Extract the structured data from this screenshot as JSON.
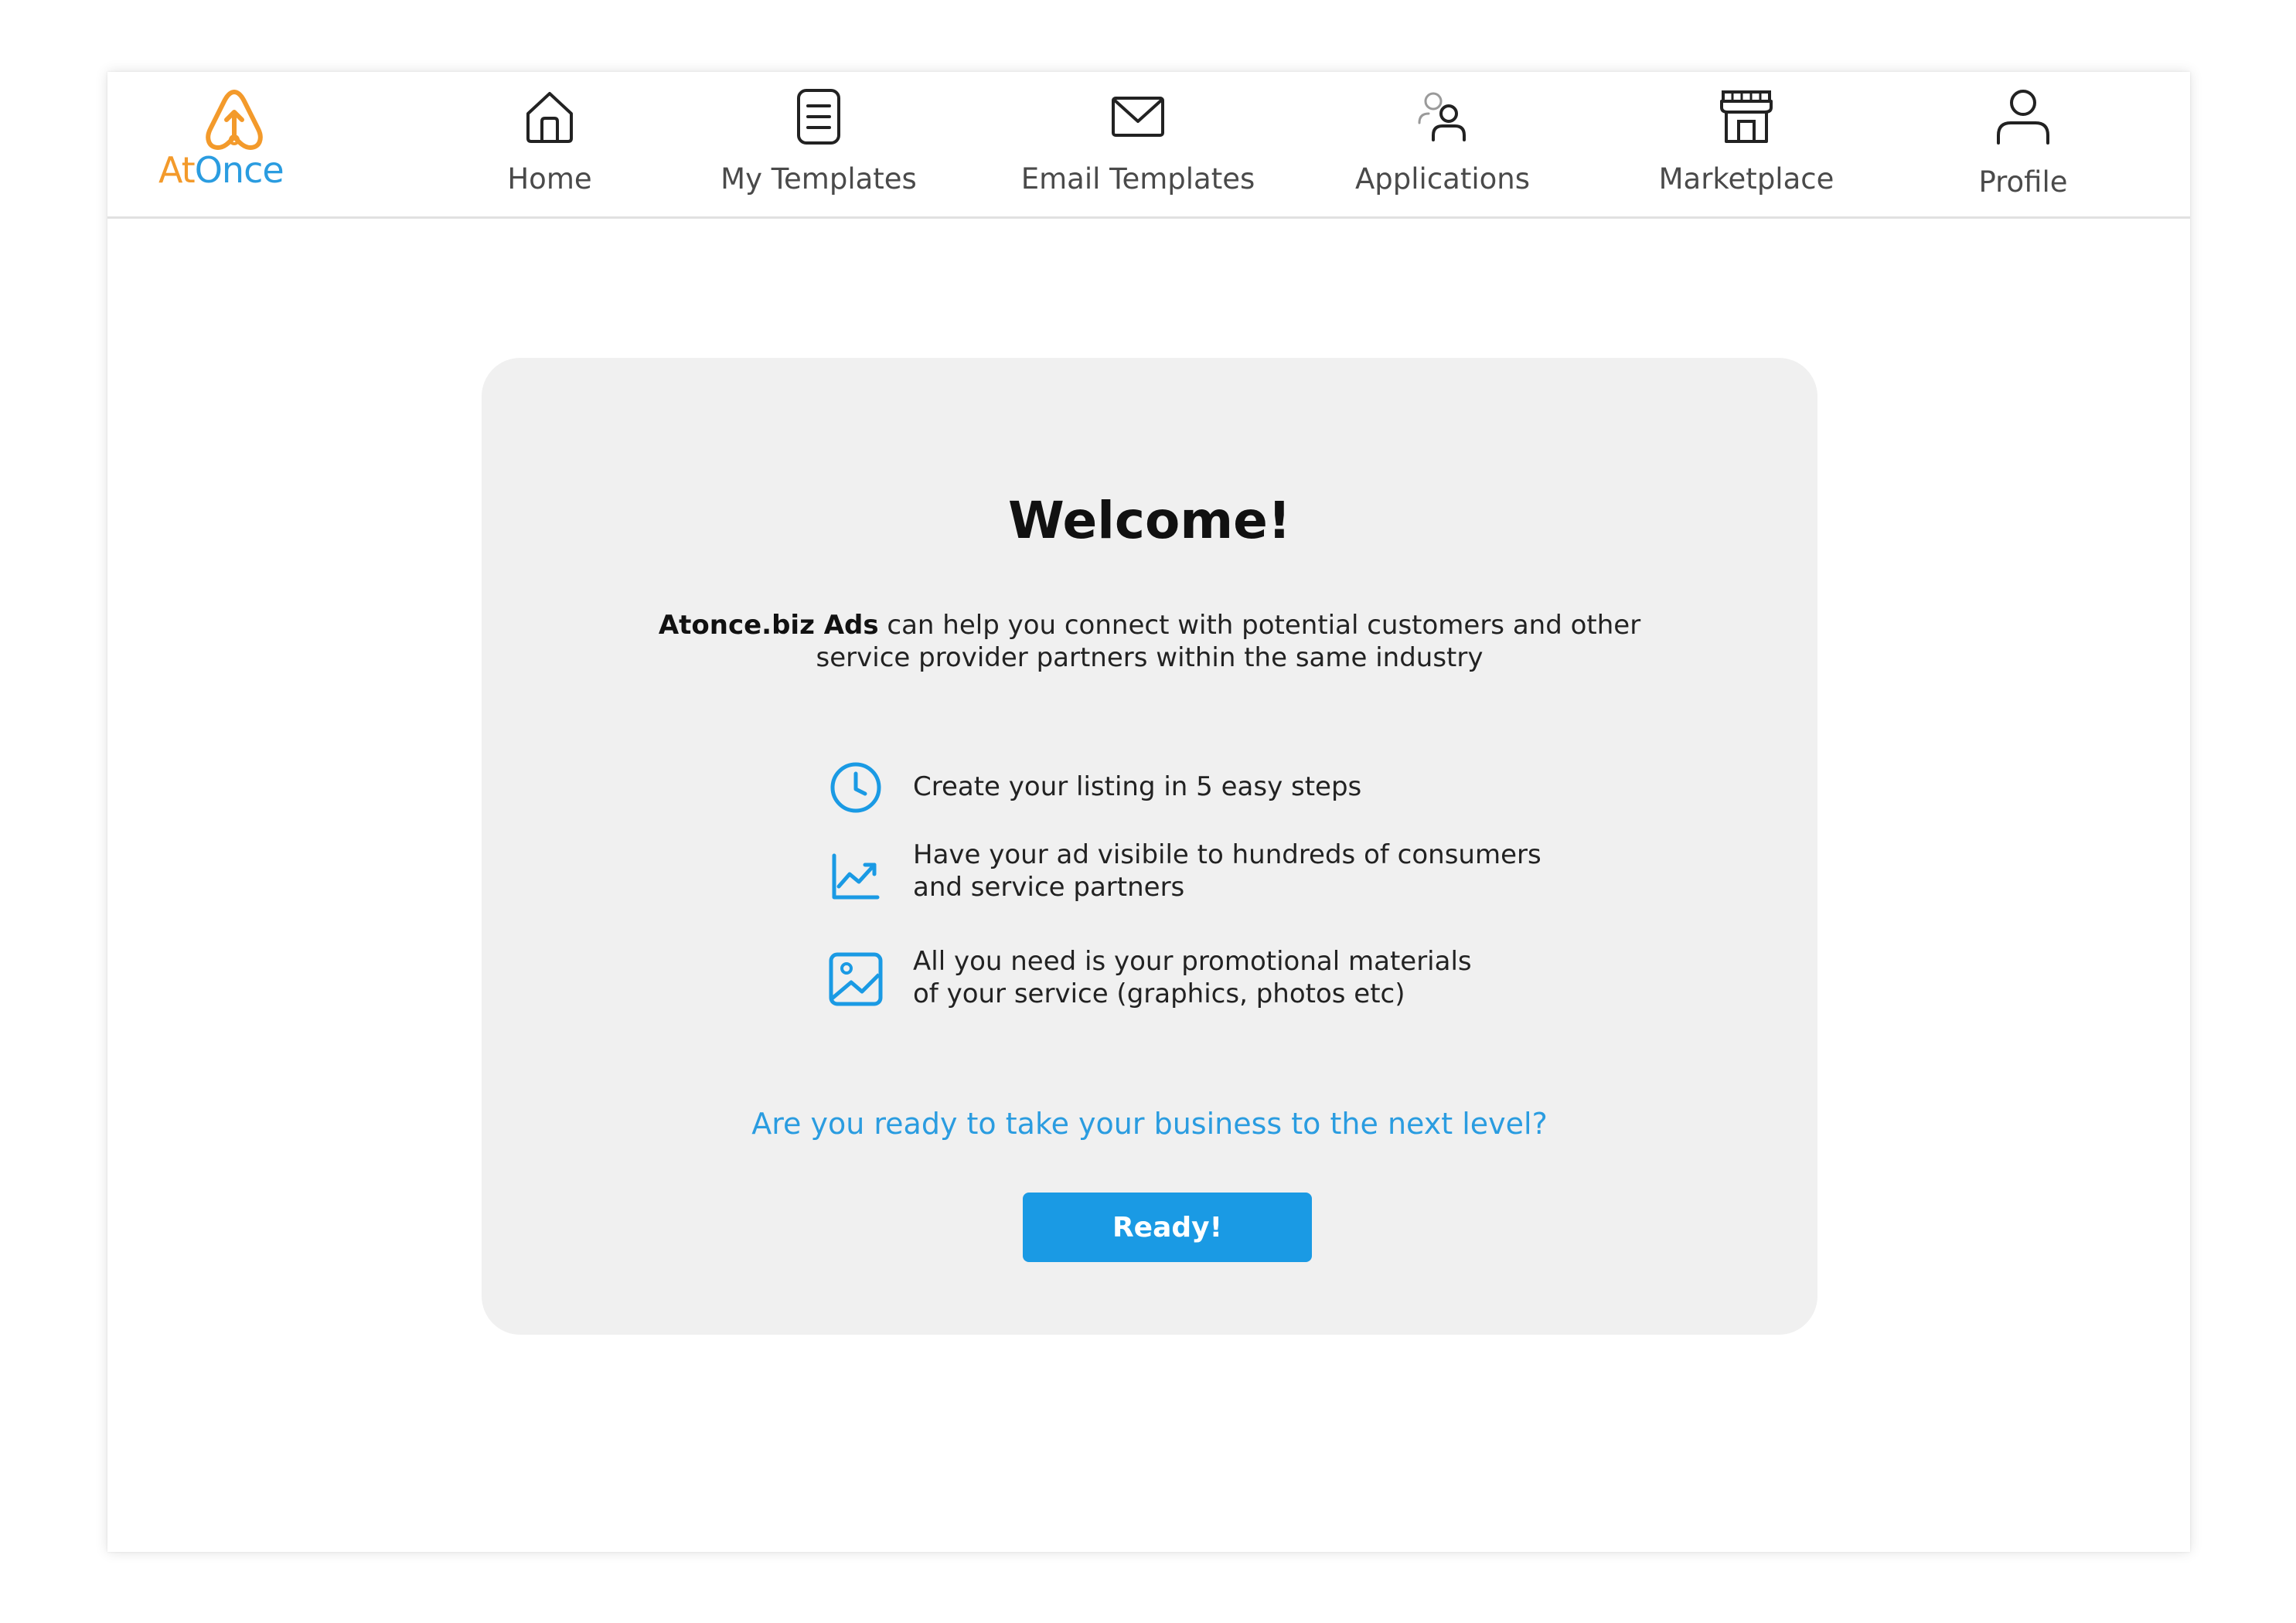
{
  "brand": {
    "name_part1": "At",
    "name_part2": "Once",
    "colors": {
      "orange": "#f39a2b",
      "blue": "#2a9ce0"
    }
  },
  "nav": {
    "items": [
      {
        "label": "Home",
        "icon": "home-icon"
      },
      {
        "label": "My Templates",
        "icon": "document-icon"
      },
      {
        "label": "Email Templates",
        "icon": "envelope-icon"
      },
      {
        "label": "Applications",
        "icon": "users-icon"
      },
      {
        "label": "Marketplace",
        "icon": "storefront-icon"
      },
      {
        "label": "Profile",
        "icon": "person-icon"
      }
    ]
  },
  "welcome": {
    "title": "Welcome!",
    "intro_brand": "Atonce.biz Ads",
    "intro_rest": " can help you connect with potential customers and other service provider partners within the same industry",
    "features": [
      {
        "icon": "clock-icon",
        "text": "Create your listing in 5 easy steps"
      },
      {
        "icon": "trending-chart-icon",
        "text": "Have your ad visibile to hundreds of consumers\nand service partners"
      },
      {
        "icon": "image-icon",
        "text": "All you need is your promotional materials\nof your service (graphics, photos etc)"
      }
    ],
    "question": "Are you ready to take your business to the next level?",
    "button_label": "Ready!",
    "accent_color": "#1a9ae4"
  }
}
